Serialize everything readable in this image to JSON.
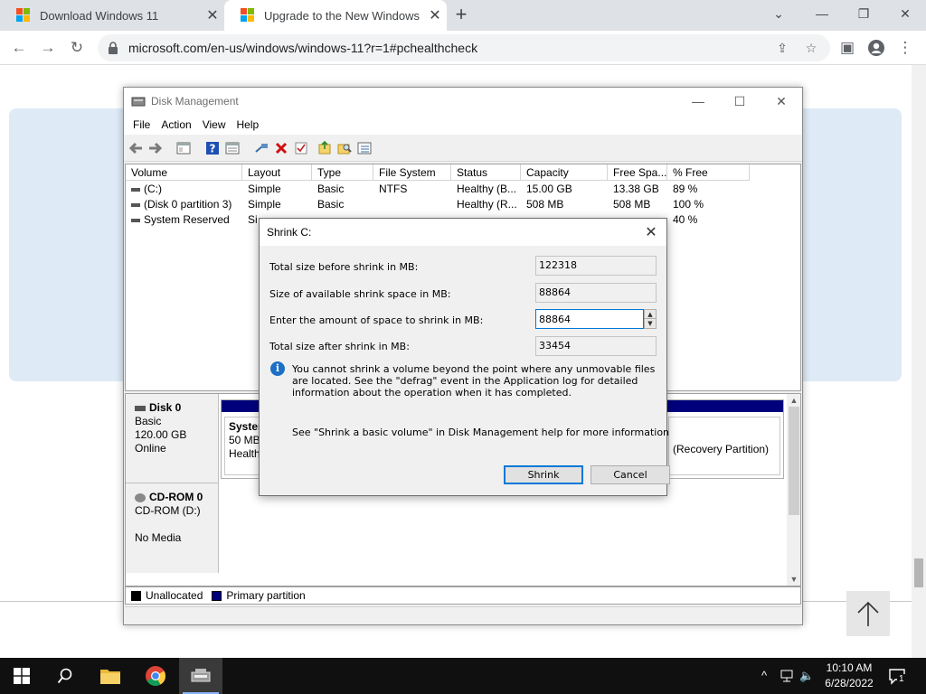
{
  "browser": {
    "tabs": [
      {
        "title": "Download Windows 11"
      },
      {
        "title": "Upgrade to the New Windows 11"
      }
    ],
    "url": "microsoft.com/en-us/windows/windows-11?r=1#pchealthcheck",
    "brand_colors": [
      "#f25022",
      "#7fba00",
      "#00a4ef",
      "#ffb900"
    ]
  },
  "disk_mgmt": {
    "title": "Disk Management",
    "menu": [
      "File",
      "Action",
      "View",
      "Help"
    ],
    "columns": [
      "Volume",
      "Layout",
      "Type",
      "File System",
      "Status",
      "Capacity",
      "Free Spa...",
      "% Free"
    ],
    "rows": [
      {
        "volume": "(C:)",
        "layout": "Simple",
        "type": "Basic",
        "fs": "NTFS",
        "status": "Healthy (B...",
        "capacity": "15.00 GB",
        "free": "13.38 GB",
        "pct": "89 %"
      },
      {
        "volume": "(Disk 0 partition 3)",
        "layout": "Simple",
        "type": "Basic",
        "fs": "",
        "status": "Healthy (R...",
        "capacity": "508 MB",
        "free": "508 MB",
        "pct": "100 %"
      },
      {
        "volume": "System Reserved",
        "layout": "Si",
        "type": "",
        "fs": "",
        "status": "",
        "capacity": "",
        "free": "",
        "pct": "40 %"
      }
    ],
    "disks": [
      {
        "name": "Disk 0",
        "kind": "Basic",
        "size": "120.00 GB",
        "state": "Online"
      },
      {
        "name": "CD-ROM 0",
        "kind": "CD-ROM (D:)",
        "size": "",
        "state": "No Media"
      }
    ],
    "partitions": {
      "system": {
        "name": "System",
        "size": "50 MB",
        "status": "Healthy"
      },
      "recovery": {
        "label": "(Recovery Partition)"
      }
    },
    "legend": {
      "unallocated": "Unallocated",
      "primary": "Primary partition"
    },
    "colors": {
      "primary": "#00007c",
      "unallocated": "#000000"
    }
  },
  "shrink": {
    "title": "Shrink C:",
    "total_before_label": "Total size before shrink in MB:",
    "total_before_value": "122318",
    "available_label": "Size of available shrink space in MB:",
    "available_value": "88864",
    "amount_label": "Enter the amount of space to shrink in MB:",
    "amount_value": "88864",
    "total_after_label": "Total size after shrink in MB:",
    "total_after_value": "33454",
    "info": "You cannot shrink a volume beyond the point where any unmovable files are located. See the \"defrag\" event in the Application log for detailed information about the operation when it has completed.",
    "help": "See \"Shrink a basic volume\" in Disk Management help for more information",
    "shrink_button": "Shrink",
    "cancel_button": "Cancel"
  },
  "taskbar": {
    "time": "10:10 AM",
    "date": "6/28/2022",
    "notifications": "1"
  }
}
